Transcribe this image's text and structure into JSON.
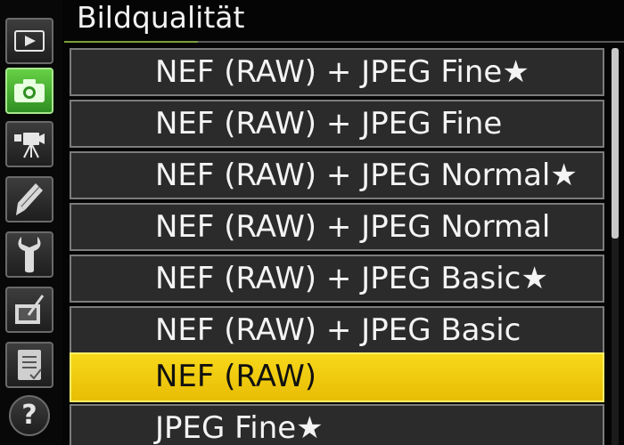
{
  "header": {
    "title": "Bildqualität"
  },
  "sidebar": {
    "items": [
      {
        "name": "playback-icon",
        "active": false
      },
      {
        "name": "camera-icon",
        "active": true
      },
      {
        "name": "movie-camera-icon",
        "active": false
      },
      {
        "name": "pencil-icon",
        "active": false
      },
      {
        "name": "wrench-icon",
        "active": false
      },
      {
        "name": "retouch-icon",
        "active": false
      },
      {
        "name": "my-menu-icon",
        "active": false
      },
      {
        "name": "help-icon",
        "active": false
      }
    ],
    "help_label": "?"
  },
  "menu": {
    "items": [
      {
        "label": "NEF (RAW) + JPEG Fine★",
        "selected": false
      },
      {
        "label": "NEF (RAW) + JPEG Fine",
        "selected": false
      },
      {
        "label": "NEF (RAW) + JPEG Normal★",
        "selected": false
      },
      {
        "label": "NEF (RAW) + JPEG Normal",
        "selected": false
      },
      {
        "label": "NEF (RAW) + JPEG Basic★",
        "selected": false
      },
      {
        "label": "NEF (RAW) + JPEG Basic",
        "selected": false
      },
      {
        "label": "NEF (RAW)",
        "selected": true
      },
      {
        "label": "JPEG Fine★",
        "selected": false
      }
    ]
  },
  "scrollbar": {
    "visible_fraction": 0.48,
    "position_fraction": 0.0
  },
  "colors": {
    "accent_active_tab": "#4fbf35",
    "selected_row": "#f2cc0f",
    "row_background": "#2b2b2b"
  }
}
